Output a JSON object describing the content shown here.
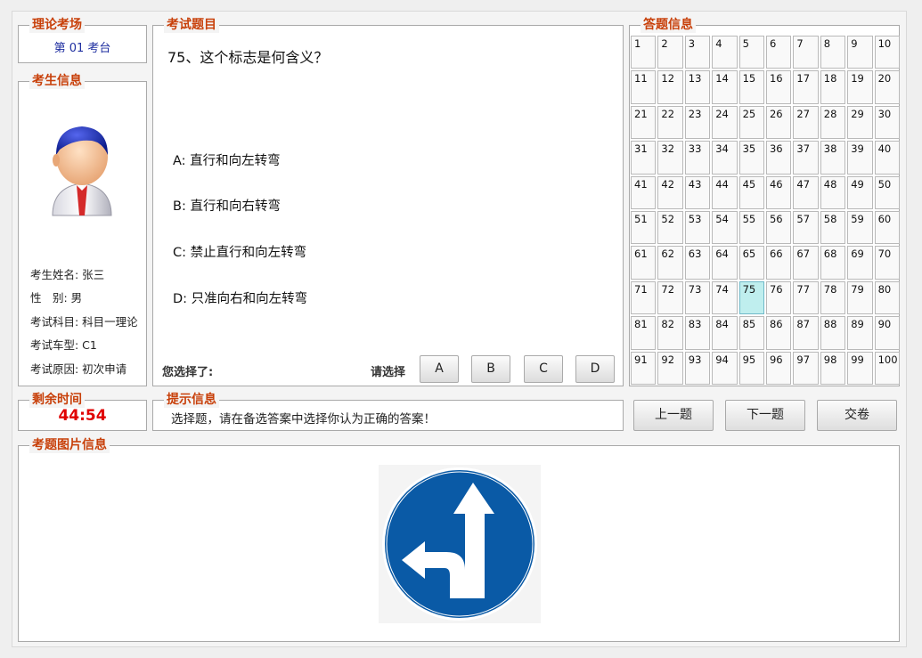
{
  "exam_hall": {
    "title": "理论考场",
    "seat": "第 01 考台"
  },
  "examinee": {
    "title": "考生信息",
    "name_line": "考生姓名: 张三",
    "gender_line": "性　别: 男",
    "subject_line": "考试科目: 科目一理论",
    "vehicle_line": "考试车型: C1",
    "reason_line": "考试原因: 初次申请"
  },
  "question": {
    "title": "考试题目",
    "text": "75、这个标志是何含义？",
    "options": [
      "A: 直行和向左转弯",
      "B: 直行和向右转弯",
      "C: 禁止直行和向左转弯",
      "D: 只准向右和向左转弯"
    ],
    "selected_label": "您选择了:",
    "please_label": "请选择",
    "choice_buttons": [
      "A",
      "B",
      "C",
      "D"
    ]
  },
  "answer_info": {
    "title": "答题信息",
    "cells": [
      "1",
      "2",
      "3",
      "4",
      "5",
      "6",
      "7",
      "8",
      "9",
      "10",
      "11",
      "12",
      "13",
      "14",
      "15",
      "16",
      "17",
      "18",
      "19",
      "20",
      "21",
      "22",
      "23",
      "24",
      "25",
      "26",
      "27",
      "28",
      "29",
      "30",
      "31",
      "32",
      "33",
      "34",
      "35",
      "36",
      "37",
      "38",
      "39",
      "40",
      "41",
      "42",
      "43",
      "44",
      "45",
      "46",
      "47",
      "48",
      "49",
      "50",
      "51",
      "52",
      "53",
      "54",
      "55",
      "56",
      "57",
      "58",
      "59",
      "60",
      "61",
      "62",
      "63",
      "64",
      "65",
      "66",
      "67",
      "68",
      "69",
      "70",
      "71",
      "72",
      "73",
      "74",
      "75",
      "76",
      "77",
      "78",
      "79",
      "80",
      "81",
      "82",
      "83",
      "84",
      "85",
      "86",
      "87",
      "88",
      "89",
      "90",
      "91",
      "92",
      "93",
      "94",
      "95",
      "96",
      "97",
      "98",
      "99",
      "100"
    ],
    "current": 75
  },
  "time": {
    "title": "剩余时间",
    "value": "44:54"
  },
  "hint": {
    "title": "提示信息",
    "text": "选择题，请在备选答案中选择你认为正确的答案！"
  },
  "nav": {
    "prev": "上一题",
    "next": "下一题",
    "submit": "交卷"
  },
  "image_info": {
    "title": "考题图片信息"
  },
  "sign_icon": "straight-or-left-turn-sign-icon"
}
